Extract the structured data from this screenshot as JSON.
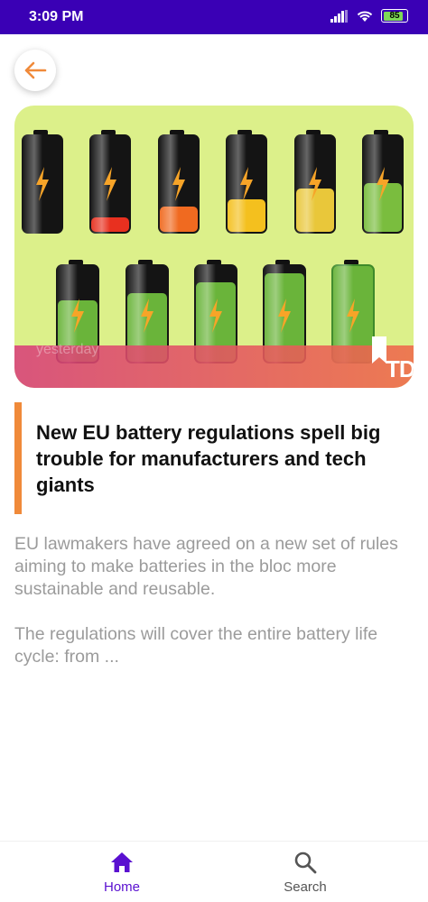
{
  "status_bar": {
    "time": "3:09 PM",
    "battery_percent": "85",
    "battery_level": 0.85
  },
  "icons": {
    "back": "arrow-left-icon",
    "home": "home-icon",
    "search": "search-icon",
    "bookmark": "bookmark-icon"
  },
  "colors": {
    "status_bar_bg": "#3a00b5",
    "accent": "#f08a3a",
    "nav_active": "#5a10d0"
  },
  "article": {
    "date": "yesterday",
    "hero_logo_text": "TD",
    "title": "New EU battery regulations spell big trouble for manufacturers and tech giants",
    "summary": "EU lawmakers have agreed on a new set of rules aiming to make batteries in the bloc more sustainable and reusable.\n\nThe regulations will cover the entire battery life cycle: from ..."
  },
  "bottom_nav": {
    "home_label": "Home",
    "search_label": "Search"
  }
}
